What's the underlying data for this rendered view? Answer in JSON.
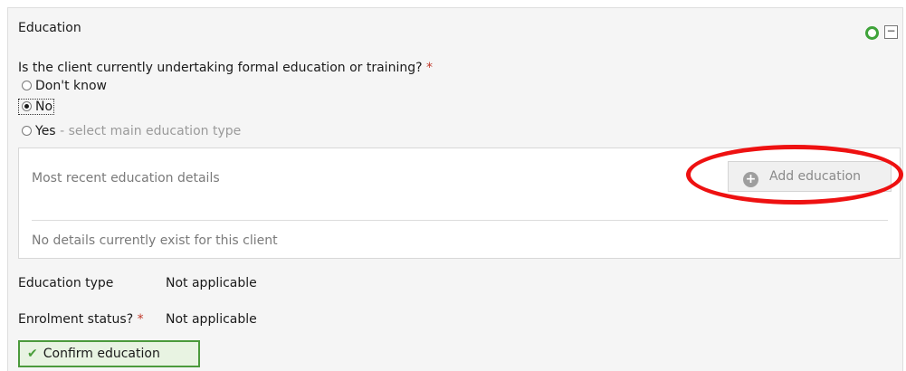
{
  "section": {
    "title": "Education"
  },
  "question": {
    "text": "Is the client currently undertaking formal education or training?",
    "required_marker": "*"
  },
  "options": [
    {
      "label": "Don't know",
      "hint": "",
      "selected": false
    },
    {
      "label": "No",
      "hint": "",
      "selected": true
    },
    {
      "label": "Yes",
      "hint": "- select main education type",
      "selected": false
    }
  ],
  "recent": {
    "label": "Most recent education details",
    "add_button": "Add education",
    "empty_text": "No details currently exist for this client"
  },
  "fields": {
    "education_type_label": "Education type",
    "education_type_value": "Not applicable",
    "enrolment_label": "Enrolment status?",
    "enrolment_required": "*",
    "enrolment_value": "Not applicable"
  },
  "confirm_button": "Confirm education",
  "icons": {
    "status": "status-circle-icon",
    "collapse": "collapse-minus-icon",
    "add": "plus-circle-icon",
    "confirm": "checkmark-icon"
  },
  "colors": {
    "status_green": "#3fa33a",
    "highlight_red": "#ee1111",
    "confirm_border": "#4b9a3c"
  }
}
